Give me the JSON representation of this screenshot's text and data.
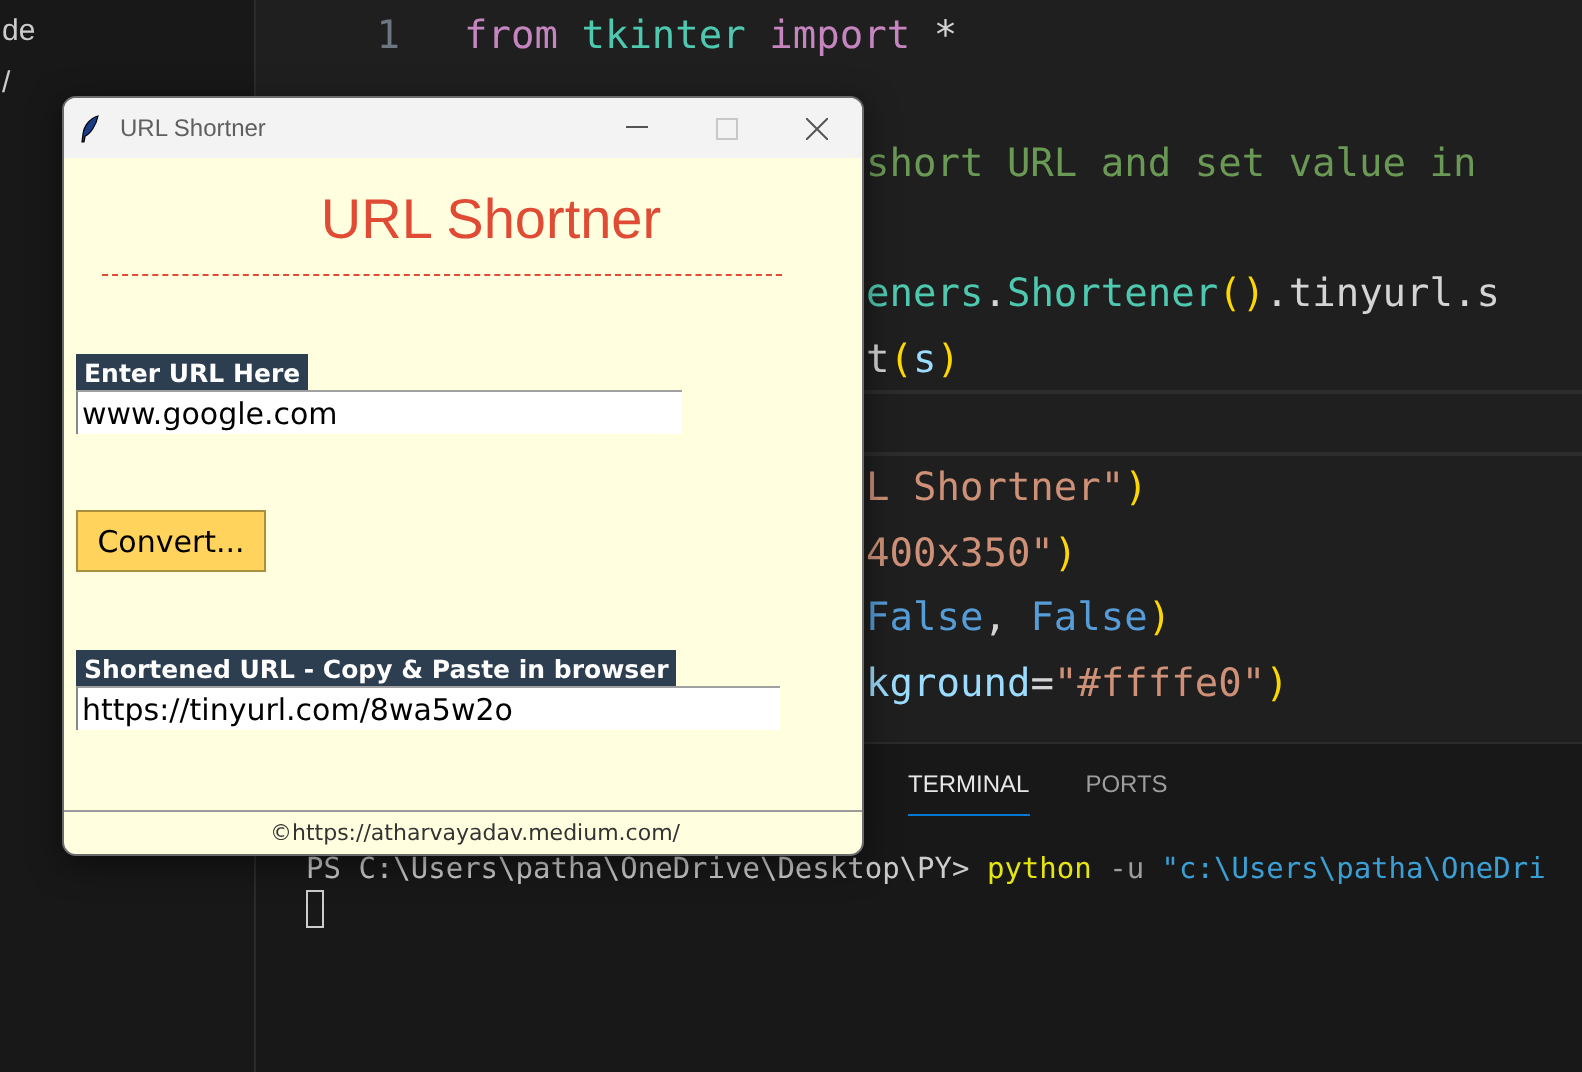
{
  "sidebar": {
    "fragments": [
      "de",
      "/"
    ]
  },
  "editor": {
    "lines": [
      {
        "kind": "code",
        "current": false,
        "number": "1",
        "tokens": [
          {
            "kind": "keyword",
            "text": "from"
          },
          {
            "kind": "module",
            "text": " tkinter"
          },
          {
            "kind": "keyword",
            "text": " import"
          },
          {
            "kind": "plain",
            "text": " *"
          }
        ]
      },
      {
        "kind": "blank",
        "current": false
      },
      {
        "kind": "partial",
        "current": false,
        "tokens": [
          {
            "kind": "comment",
            "text": "short URL and set value in"
          }
        ]
      },
      {
        "kind": "blank",
        "current": false
      },
      {
        "kind": "partial",
        "current": false,
        "tokens": [
          {
            "kind": "module",
            "text": "eners"
          },
          {
            "kind": "plain",
            "text": "."
          },
          {
            "kind": "module",
            "text": "Shortener"
          },
          {
            "kind": "bracket",
            "text": "()"
          },
          {
            "kind": "plain",
            "text": ".tinyurl.s"
          }
        ]
      },
      {
        "kind": "partial",
        "current": false,
        "tokens": [
          {
            "kind": "plain",
            "text": "t"
          },
          {
            "kind": "bracket",
            "text": "("
          },
          {
            "kind": "variable",
            "text": "s"
          },
          {
            "kind": "bracket",
            "text": ")"
          }
        ]
      },
      {
        "kind": "blank",
        "current": true
      },
      {
        "kind": "partial",
        "current": false,
        "tokens": [
          {
            "kind": "string",
            "text": "L Shortner\""
          },
          {
            "kind": "bracket",
            "text": ")"
          }
        ]
      },
      {
        "kind": "partial",
        "current": false,
        "tokens": [
          {
            "kind": "string",
            "text": "400x350\""
          },
          {
            "kind": "bracket",
            "text": ")"
          }
        ]
      },
      {
        "kind": "partial",
        "current": false,
        "tokens": [
          {
            "kind": "constant",
            "text": "False"
          },
          {
            "kind": "plain",
            "text": ", "
          },
          {
            "kind": "constant",
            "text": "False"
          },
          {
            "kind": "bracket",
            "text": ")"
          }
        ]
      },
      {
        "kind": "partial",
        "current": false,
        "tokens": [
          {
            "kind": "variable",
            "text": "kground"
          },
          {
            "kind": "plain",
            "text": "="
          },
          {
            "kind": "string",
            "text": "\"#ffffe0\""
          },
          {
            "kind": "bracket",
            "text": ")"
          }
        ]
      }
    ]
  },
  "panel": {
    "tabs": [
      {
        "label": "TERMINAL",
        "selected": true
      },
      {
        "label": "PORTS",
        "selected": false
      }
    ],
    "terminal_line": [
      {
        "kind": "prompt",
        "text": "PS C:\\Users\\patha\\OneDrive\\Desktop\\PY> "
      },
      {
        "kind": "command",
        "text": "python"
      },
      {
        "kind": "flag",
        "text": " -u"
      },
      {
        "kind": "string",
        "text": " \"c:\\Users\\patha\\OneDri"
      }
    ]
  },
  "window": {
    "title": "URL Shortner",
    "controls": [
      {
        "kind": "minimize",
        "disabled": false
      },
      {
        "kind": "maximize",
        "disabled": true
      },
      {
        "kind": "close",
        "disabled": false
      }
    ],
    "heading": "URL Shortner",
    "input_label": "Enter URL Here",
    "input_value": "www.google.com",
    "button": "Convert...",
    "output_label": "Shortened URL - Copy & Paste in browser",
    "output_value": "https://tinyurl.com/8wa5w2o",
    "footer": "©https://atharvayadav.medium.com/"
  }
}
